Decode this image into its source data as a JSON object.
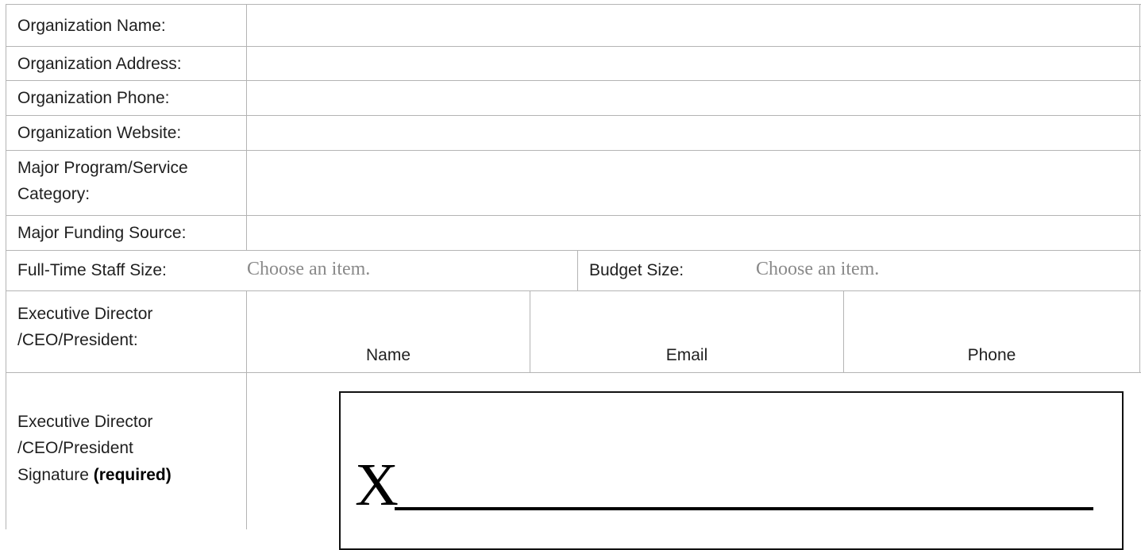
{
  "form": {
    "rows": [
      {
        "label": "Organization Name:"
      },
      {
        "label": "Organization Address:"
      },
      {
        "label": "Organization Phone:"
      },
      {
        "label": "Organization Website:"
      },
      {
        "label_line1": "Major Program/Service",
        "label_line2": "Category:"
      },
      {
        "label": "Major Funding Source:"
      }
    ],
    "staff": {
      "label": "Full-Time Staff Size:",
      "placeholder": "Choose an item."
    },
    "budget": {
      "label": "Budget Size:",
      "placeholder": "Choose an item."
    },
    "executive": {
      "label_line1": "Executive Director",
      "label_line2": "/CEO/President:",
      "name_caption": "Name",
      "email_caption": "Email",
      "phone_caption": "Phone"
    },
    "signature": {
      "label_line1": "Executive Director",
      "label_line2": "/CEO/President",
      "label_line3_prefix": "Signature ",
      "label_required": "(required)",
      "x_mark": "X"
    }
  }
}
